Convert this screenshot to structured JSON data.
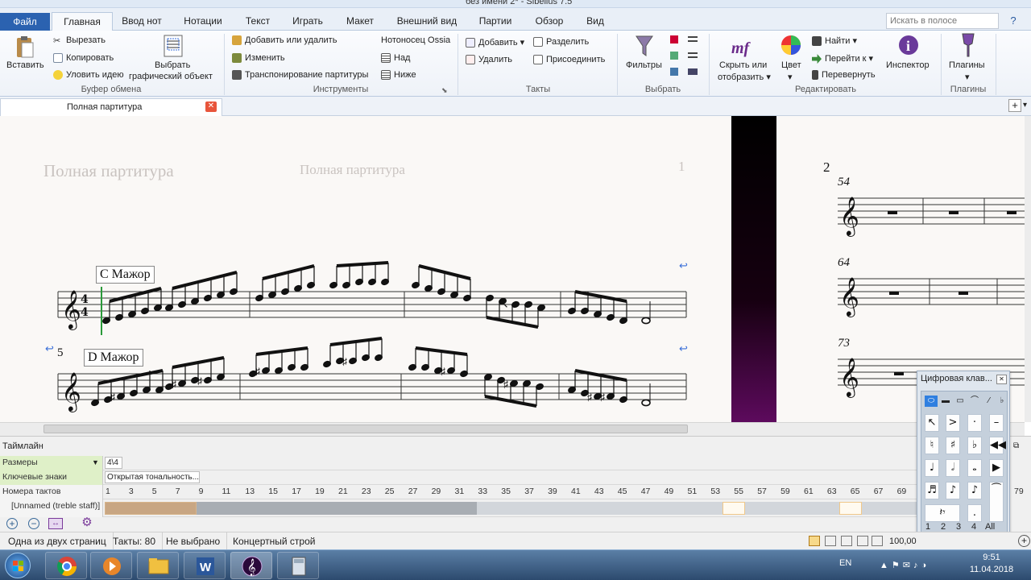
{
  "window": {
    "title": "без имени 2* - Sibelius 7.5"
  },
  "tabs": [
    "Файл",
    "Главная",
    "Ввод нот",
    "Нотации",
    "Текст",
    "Играть",
    "Макет",
    "Внешний вид",
    "Партии",
    "Обзор",
    "Вид"
  ],
  "search": {
    "placeholder": "Искать в полосе"
  },
  "ribbon": {
    "clipboard": {
      "paste": "Вставить",
      "cut": "Вырезать",
      "copy": "Копировать",
      "capture": "Уловить идею",
      "select_graphic_1": "Выбрать",
      "select_graphic_2": "графический объект",
      "group": "Буфер обмена"
    },
    "instruments": {
      "add_remove": "Добавить или удалить",
      "change": "Изменить",
      "transpose": "Транспонирование партитуры",
      "ossia": "Нотоносец Ossia",
      "above": "Над",
      "below": "Ниже",
      "group": "Инструменты"
    },
    "bars": {
      "add": "Добавить",
      "delete": "Удалить",
      "split": "Разделить",
      "join": "Присоединить",
      "group": "Такты"
    },
    "select": {
      "filters": "Фильтры",
      "group": "Выбрать"
    },
    "edit": {
      "hide_show_1": "Скрыть или",
      "hide_show_2": "отобразить",
      "color": "Цвет",
      "find": "Найти",
      "goto": "Перейти к",
      "flip": "Перевернуть",
      "inspector": "Инспектор",
      "group": "Редактировать"
    },
    "plugins": {
      "plugins": "Плагины",
      "group": "Плагины"
    }
  },
  "document_tab": {
    "label": "Полная партитура"
  },
  "score": {
    "page1_header_left": "Полная партитура",
    "page1_header_center": "Полная партитура",
    "page1_number": "1",
    "key_c": "C Мажор",
    "key_d": "D Мажор",
    "bar5": "5",
    "page2_number": "2",
    "bar54": "54",
    "bar64": "64",
    "bar73": "73"
  },
  "timeline": {
    "title": "Таймлайн",
    "rows": {
      "sizes": "Размеры",
      "key_sigs": "Ключевые знаки",
      "bar_numbers": "Номера тактов",
      "staff": "[Unnamed (treble staff)]"
    },
    "time_sig": "4\\4",
    "key_sig": "Открытая тональность...",
    "bar_numbers": [
      "1",
      "3",
      "5",
      "7",
      "9",
      "11",
      "13",
      "15",
      "17",
      "19",
      "21",
      "23",
      "25",
      "27",
      "29",
      "31",
      "33",
      "35",
      "37",
      "39",
      "41",
      "43",
      "45",
      "47",
      "49",
      "51",
      "53",
      "55",
      "57",
      "59",
      "61",
      "63",
      "65",
      "67",
      "69",
      "79"
    ]
  },
  "keypad": {
    "title": "Цифровая клав...",
    "layouts": [
      "1",
      "2",
      "3",
      "4",
      "All"
    ]
  },
  "status": {
    "pages": "Одна из двух страниц",
    "bars": "Такты: 80",
    "selection": "Не выбрано",
    "pitch": "Концертный строй",
    "zoom": "100,00"
  },
  "taskbar": {
    "lang": "EN",
    "time": "9:51",
    "date": "11.04.2018"
  }
}
